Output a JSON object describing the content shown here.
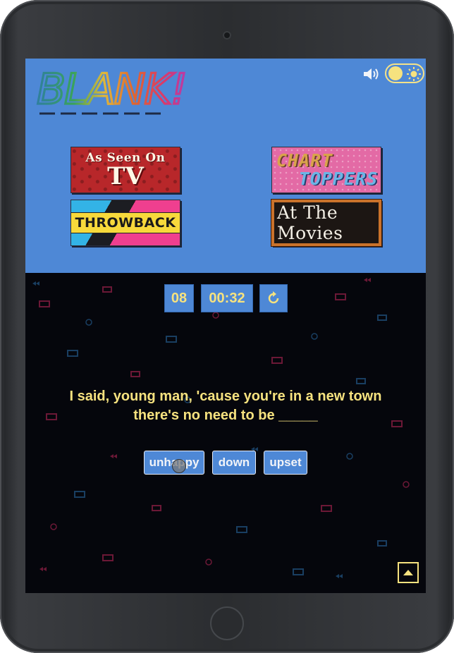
{
  "app": {
    "logo_text": "BLANK!"
  },
  "header": {
    "sound_icon": "volume-up-icon",
    "theme_icon": "sun-icon"
  },
  "categories": [
    {
      "id": "tv",
      "line1": "As Seen On",
      "line2": "TV"
    },
    {
      "id": "chart",
      "line1": "CHART",
      "line2": "TOPPERS"
    },
    {
      "id": "throwback",
      "line1": "THROWBACK"
    },
    {
      "id": "movies",
      "line1": "At The Movies"
    }
  ],
  "game": {
    "score": "08",
    "timer": "00:32",
    "restart_icon": "restart-icon",
    "lyric": "I said, young man, 'cause you're in a new town there's no need to be _____",
    "choices": [
      "unhappy",
      "down",
      "upset"
    ],
    "scroll_top_icon": "arrow-up-icon"
  },
  "colors": {
    "header_bg": "#4e88d6",
    "accent_yellow": "#f6e27f",
    "game_bg": "#05060c"
  }
}
